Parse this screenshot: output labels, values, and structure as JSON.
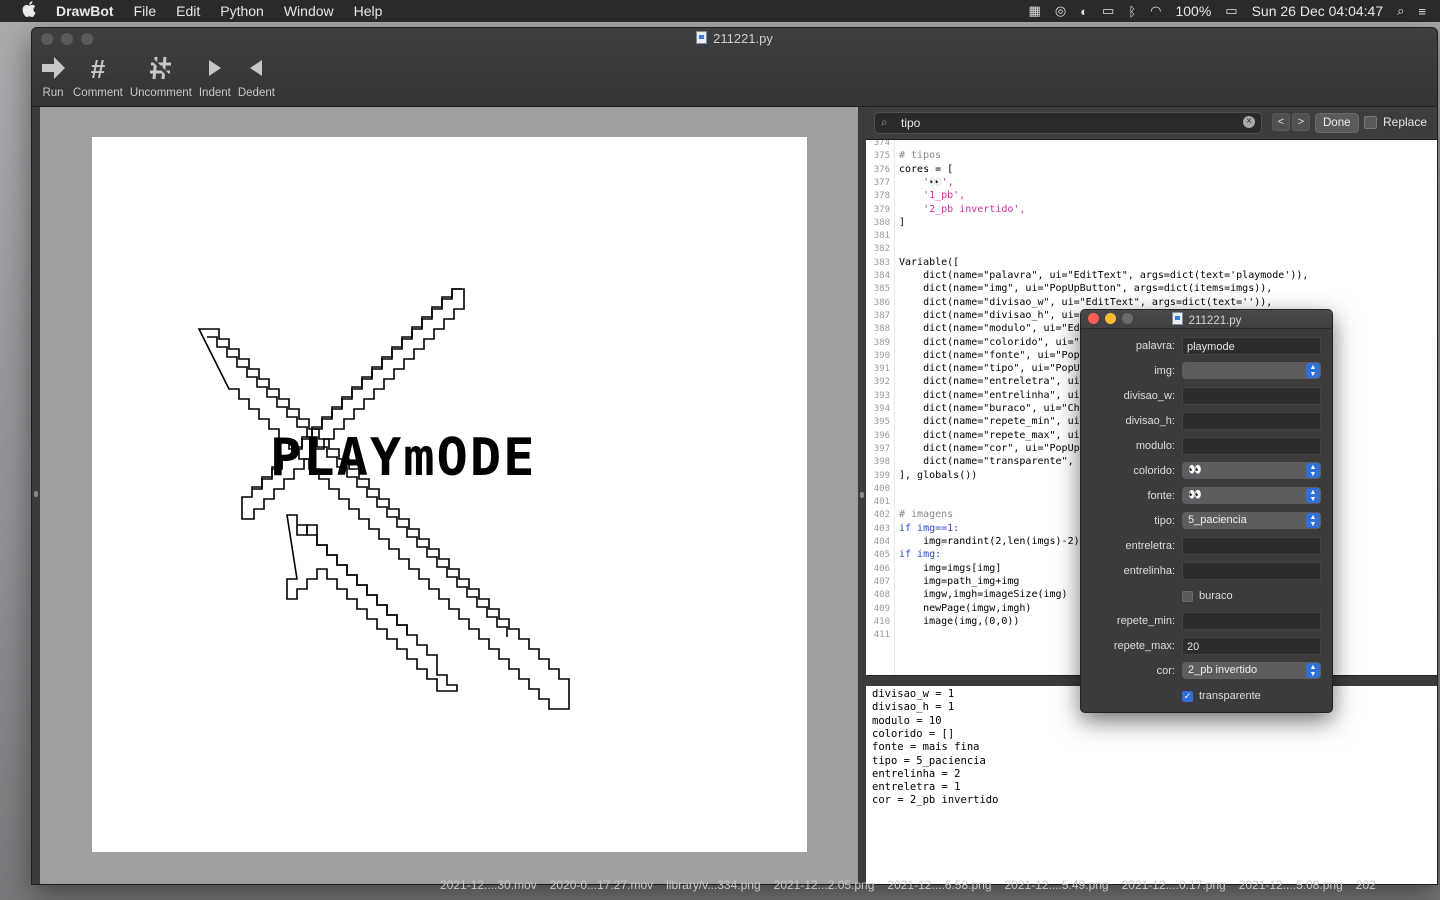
{
  "menubar": {
    "apple": "",
    "app": "DrawBot",
    "menus": [
      "File",
      "Edit",
      "Python",
      "Window",
      "Help"
    ],
    "battery": "100%",
    "datetime": "Sun 26 Dec  04:04:47"
  },
  "window": {
    "title": "211221.py",
    "toolbar": [
      {
        "label": "Run",
        "icon": "run-arrow-icon"
      },
      {
        "label": "Comment",
        "icon": "hash-icon"
      },
      {
        "label": "Uncomment",
        "icon": "uncomment-hash-icon"
      },
      {
        "label": "Indent",
        "icon": "play-triangle-icon"
      },
      {
        "label": "Dedent",
        "icon": "left-triangle-icon"
      }
    ]
  },
  "find": {
    "query": "tipo",
    "done_label": "Done",
    "replace_label": "Replace",
    "prev": "<",
    "next": ">"
  },
  "canvas": {
    "word": "PLAYmODE"
  },
  "code": [
    {
      "n": "374",
      "text": ""
    },
    {
      "n": "375",
      "text": "# tipos"
    },
    {
      "n": "376",
      "text": "cores = ["
    },
    {
      "n": "377",
      "text": "    '👀',"
    },
    {
      "n": "378",
      "text": "    '1_pb',"
    },
    {
      "n": "379",
      "text": "    '2_pb invertido',"
    },
    {
      "n": "380",
      "text": "]"
    },
    {
      "n": "381",
      "text": ""
    },
    {
      "n": "382",
      "text": ""
    },
    {
      "n": "383",
      "text": "Variable(["
    },
    {
      "n": "384",
      "text": "    dict(name=\"palavra\", ui=\"EditText\", args=dict(text='playmode')),"
    },
    {
      "n": "385",
      "text": "    dict(name=\"img\", ui=\"PopUpButton\", args=dict(items=imgs)),"
    },
    {
      "n": "386",
      "text": "    dict(name=\"divisao_w\", ui=\"EditText\", args=dict(text='')),"
    },
    {
      "n": "387",
      "text": "    dict(name=\"divisao_h\", ui="
    },
    {
      "n": "388",
      "text": "    dict(name=\"modulo\", ui=\"Ed"
    },
    {
      "n": "389",
      "text": "    dict(name=\"colorido\", ui=\""
    },
    {
      "n": "390",
      "text": "    dict(name=\"fonte\", ui=\"Pop"
    },
    {
      "n": "391",
      "text": "    dict(name=\"tipo\", ui=\"PopU"
    },
    {
      "n": "392",
      "text": "    dict(name=\"entreletra\", ui"
    },
    {
      "n": "393",
      "text": "    dict(name=\"entrelinha\", ui"
    },
    {
      "n": "394",
      "text": "    dict(name=\"buraco\", ui=\"Ch"
    },
    {
      "n": "395",
      "text": "    dict(name=\"repete_min\", ui"
    },
    {
      "n": "396",
      "text": "    dict(name=\"repete_max\", ui"
    },
    {
      "n": "397",
      "text": "    dict(name=\"cor\", ui=\"PopUp"
    },
    {
      "n": "398",
      "text": "    dict(name=\"transparente\","
    },
    {
      "n": "399",
      "text": "], globals())"
    },
    {
      "n": "400",
      "text": ""
    },
    {
      "n": "401",
      "text": ""
    },
    {
      "n": "402",
      "text": "# imagens"
    },
    {
      "n": "403",
      "text": "if img==1:"
    },
    {
      "n": "404",
      "text": "    img=randint(2,len(imgs)-2)"
    },
    {
      "n": "405",
      "text": "if img:"
    },
    {
      "n": "406",
      "text": "    img=imgs[img]"
    },
    {
      "n": "407",
      "text": "    img=path_img+img"
    },
    {
      "n": "408",
      "text": "    imgw,imgh=imageSize(img)"
    },
    {
      "n": "409",
      "text": "    newPage(imgw,imgh)"
    },
    {
      "n": "410",
      "text": "    image(img,(0,0))"
    },
    {
      "n": "411",
      "text": ""
    }
  ],
  "output": [
    "divisao_w = 1",
    "divisao_h = 1",
    "modulo = 10",
    "colorido = []",
    "fonte = mais fina",
    "tipo = 5_paciencia",
    "entrelinha = 2",
    "entreletra = 1",
    "cor = 2_pb invertido"
  ],
  "variables_window": {
    "title": "211221.py",
    "fields": [
      {
        "label": "palavra:",
        "kind": "text",
        "value": "playmode"
      },
      {
        "label": "img:",
        "kind": "popup",
        "value": ""
      },
      {
        "label": "divisao_w:",
        "kind": "text",
        "value": ""
      },
      {
        "label": "divisao_h:",
        "kind": "text",
        "value": ""
      },
      {
        "label": "modulo:",
        "kind": "text",
        "value": ""
      },
      {
        "label": "colorido:",
        "kind": "popup",
        "value": "👀"
      },
      {
        "label": "fonte:",
        "kind": "popup",
        "value": "👀"
      },
      {
        "label": "tipo:",
        "kind": "popup",
        "value": "5_paciencia"
      },
      {
        "label": "entreletra:",
        "kind": "text",
        "value": ""
      },
      {
        "label": "entrelinha:",
        "kind": "text",
        "value": ""
      },
      {
        "label": "buraco",
        "kind": "checkbox",
        "checked": false
      },
      {
        "label": "repete_min:",
        "kind": "text",
        "value": ""
      },
      {
        "label": "repete_max:",
        "kind": "text",
        "value": "20"
      },
      {
        "label": "cor:",
        "kind": "popup",
        "value": "2_pb invertido"
      },
      {
        "label": "transparente",
        "kind": "checkbox",
        "checked": true
      }
    ]
  },
  "desktop_files": [
    "2021-12....30.mov",
    "2020-0...17.27.mov",
    "library/v...334.png",
    "2021-12...2.05.png",
    "2021-12....6.58.png",
    "2021-12....5.49.png",
    "2021-12....0.17.png",
    "2021-12....5.08.png",
    "202"
  ],
  "colors": {
    "accent": "#2f6fd8",
    "string": "#d12fa4",
    "keyword": "#2b49c8",
    "comment": "#8a8a8a"
  }
}
